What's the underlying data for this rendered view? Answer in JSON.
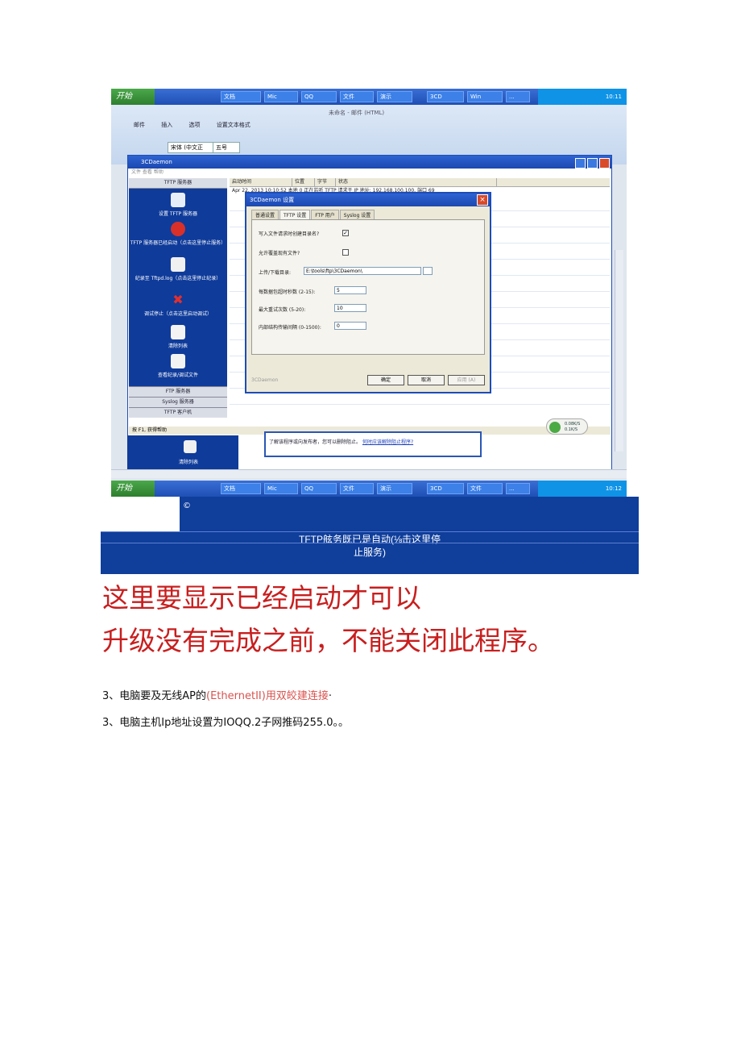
{
  "screenshot": {
    "taskbar_top": {
      "start_label": "开始",
      "buttons": [
        "文档",
        "Mic",
        "QQ",
        "文件",
        "演示",
        "3CD",
        "Win",
        "..."
      ],
      "clock": "10:11"
    },
    "taskbar_bottom": {
      "start_label": "开始",
      "buttons": [
        "文档",
        "Mic",
        "QQ",
        "文件",
        "演示",
        "3CD",
        "文件",
        "..."
      ],
      "clock": "10:12"
    },
    "word": {
      "title": "未命名 - 邮件 (HTML)",
      "tabs": [
        "邮件",
        "插入",
        "选项",
        "设置文本格式"
      ],
      "font_name": "宋体 (中文正",
      "font_size": "五号"
    },
    "daemon": {
      "title": "3CDaemon",
      "menu": "文件  查看  帮助",
      "panel_header": "TFTP 服务器",
      "panel_items": [
        "设置 TFTP 服务器",
        "TFTP 服务器已经启动（点击这里停止服务）",
        "纪录至 Tftpd.log（点击这里停止纪录）",
        "调试停止（点击这里启动调试）",
        "清除列表",
        "查看纪录/调试文件"
      ],
      "panel_footers": [
        "FTP 服务器",
        "Syslog 服务器",
        "TFTP 客户机"
      ],
      "grid_headers": [
        "启动时间",
        "位置",
        "字节",
        "状态"
      ],
      "grid_row": "Apr 22, 2013 10:10:52  本地  0  正在监听 TFTP 请求于 IP 地址: 192.168.100.100, 端口 69",
      "status_text": "按 F1, 获得帮助",
      "bottom_item": "清除列表"
    },
    "dialog": {
      "title": "3CDaemon 设置",
      "tabs": [
        "普通设置",
        "TFTP 设置",
        "FTP 用户",
        "Syslog 设置"
      ],
      "chk1_label": "写入文件请求时创建目录名?",
      "chk1_mark": "✓",
      "chk2_label": "允许覆盖现有文件?",
      "dir_label": "上传/下载目录:",
      "dir_value": "E:\\tools\\ftp\\3CDaemon\\",
      "timeout_label": "每数据包超时秒数 (2-15):",
      "timeout_value": "5",
      "retry_label": "最大重试次数 (5-20):",
      "retry_value": "10",
      "interval_label": "内部结构传输间隔 (0-1500):",
      "interval_value": "0",
      "footer": "3CDaemon",
      "ok": "确定",
      "cancel": "取消",
      "apply": "应用 (A)"
    },
    "ie_strip": {
      "text": "了解该程序或向发布者，您可以删除阻止。",
      "link": "何时应该解除阻止程序?"
    },
    "tray_popup": [
      "0.08K/S",
      "0.1K/S"
    ]
  },
  "banner": {
    "symbol": "©",
    "line1": "TFTP舷务既已是自动(⅛击这里停",
    "line2": "止服务)"
  },
  "notes": {
    "line1": "这里要显示已经启动才可以",
    "line2": "升级没有完成之前，不能关闭此程序。"
  },
  "steps": [
    {
      "prefix": "3、电脑要及无线AP的",
      "highlight": "(EthernetII)用双皎建连接",
      "suffix": "·"
    },
    {
      "text": "3、电脑主机Ip地址设置为IOQQ.2子网推码255.0。。"
    }
  ],
  "colors": {
    "banner_bg": "#0f3e9b",
    "note_red": "#c81e1e",
    "highlight": "#d9534f",
    "xp_blue": "#1f4fb4"
  }
}
